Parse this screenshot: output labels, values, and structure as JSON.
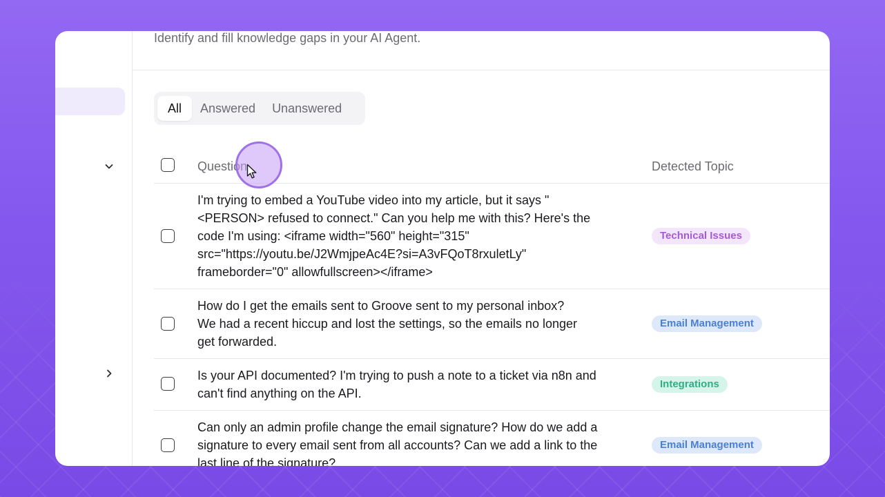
{
  "header": {
    "subtitle": "Identify and fill knowledge gaps in your AI Agent."
  },
  "tabs": [
    {
      "label": "All",
      "active": true
    },
    {
      "label": "Answered",
      "active": false
    },
    {
      "label": "Unanswered",
      "active": false
    }
  ],
  "table": {
    "columns": [
      "Question",
      "Detected Topic"
    ],
    "rows": [
      {
        "question": "I'm trying to embed a YouTube video into my article, but it says \"\n<PERSON> refused to connect.\" Can you help me with this? Here's the\ncode I'm using: <iframe width=\"560\" height=\"315\"\nsrc=\"https://youtu.be/J2WmjpeAc4E?si=A3vFQoT8rxuletLy\"\nframeborder=\"0\" allowfullscreen></iframe>",
        "topic": "Technical Issues",
        "topic_color": "purple"
      },
      {
        "question": "How do I get the emails sent to Groove sent to my personal inbox?\nWe had a recent hiccup and lost the settings, so the emails no longer\nget forwarded.",
        "topic": "Email Management",
        "topic_color": "blue"
      },
      {
        "question": "Is your API documented? I'm trying to push a note to a ticket via n8n and\ncan't find anything on the API.",
        "topic": "Integrations",
        "topic_color": "green"
      },
      {
        "question": "Can only an admin profile change the email signature? How do we add a\nsignature to every email sent from all accounts? Can we add a link to the\nlast line of the signature?",
        "topic": "Email Management",
        "topic_color": "blue"
      }
    ]
  },
  "colors": {
    "background": "#8458ee",
    "accent_ring": "#a071e6",
    "sidebar_active": "#efebfd"
  },
  "icons": {
    "sidebar_top": "chevron-down-icon",
    "sidebar_bottom": "chevron-right-icon",
    "pointer": "cursor-pointer-icon"
  }
}
